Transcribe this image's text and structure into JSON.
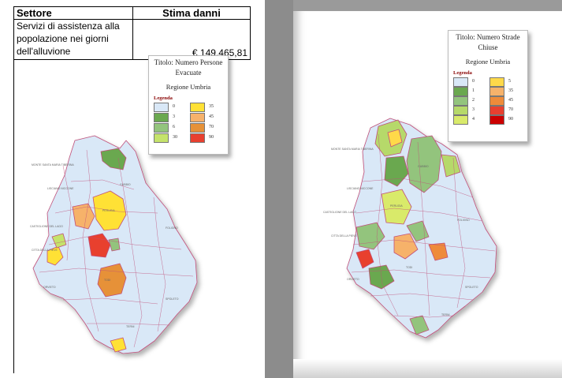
{
  "table": {
    "header_col1": "Settore",
    "header_col2": "Stima danni",
    "row_col1_line1": "Servizi di assistenza alla",
    "row_col1_line2": "popolazione nei giorni",
    "row_col1_line3": "dell'alluvione",
    "row_amount": "€ 149.465,81"
  },
  "left_map": {
    "legend_title_line1": "Titolo: Numero Persone",
    "legend_title_line2": "Evacuate",
    "legend_region": "Regione Umbria",
    "legend_heading": "Legenda",
    "legend_items": [
      {
        "value": "0",
        "color": "#d9e8f7"
      },
      {
        "value": "3",
        "color": "#6aa84f"
      },
      {
        "value": "6",
        "color": "#93c47d"
      },
      {
        "value": "30",
        "color": "#c5e36b"
      },
      {
        "value": "35",
        "color": "#ffe135"
      },
      {
        "value": "45",
        "color": "#f6b26b"
      },
      {
        "value": "70",
        "color": "#e69138"
      },
      {
        "value": "90",
        "color": "#e8402f"
      }
    ]
  },
  "right_map": {
    "legend_title_line1": "Titolo: Numero Strade",
    "legend_title_line2": "Chiuse",
    "legend_region": "Regione Umbria",
    "legend_heading": "Legenda",
    "legend_items": [
      {
        "value": "0",
        "color": "#d9e8f7"
      },
      {
        "value": "1",
        "color": "#6aa84f"
      },
      {
        "value": "2",
        "color": "#93c47d"
      },
      {
        "value": "3",
        "color": "#b6d96a"
      },
      {
        "value": "4",
        "color": "#d9ea6b"
      },
      {
        "value": "5",
        "color": "#ffd94a"
      },
      {
        "value": "35",
        "color": "#f6b26b"
      },
      {
        "value": "45",
        "color": "#ee8b3a"
      },
      {
        "value": "70",
        "color": "#e8402f"
      },
      {
        "value": "90",
        "color": "#cc0000"
      }
    ]
  }
}
